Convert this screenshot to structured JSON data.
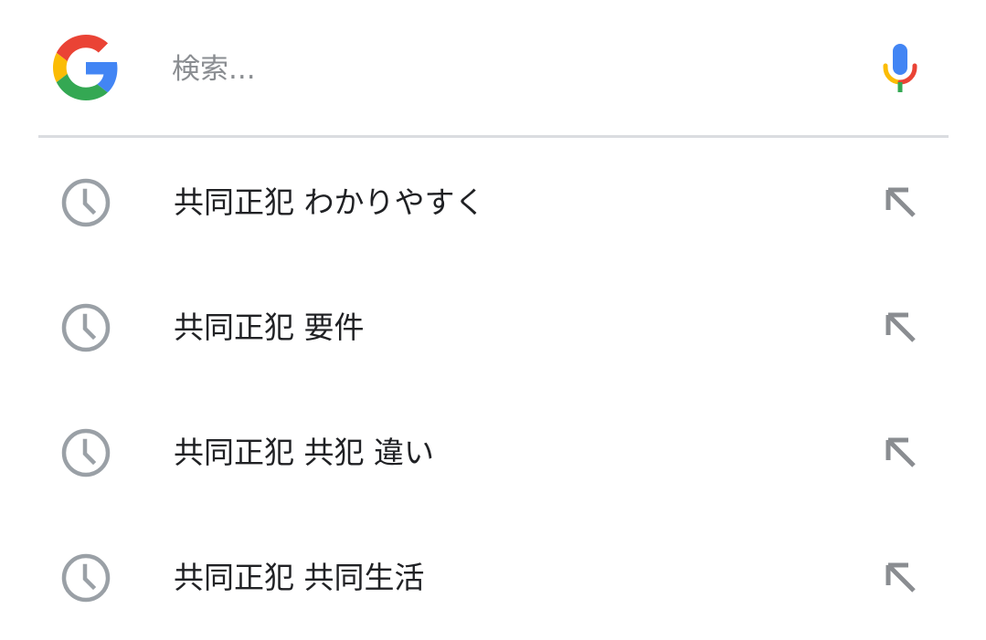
{
  "search": {
    "placeholder": "検索...",
    "value": ""
  },
  "icons": {
    "logo": "google-g-logo-icon",
    "mic": "microphone-icon",
    "history": "clock-history-icon",
    "fill": "arrow-up-left-icon"
  },
  "colors": {
    "google_blue": "#4285F4",
    "google_red": "#EA4335",
    "google_yellow": "#FBBC05",
    "google_green": "#34A853",
    "icon_gray": "#9aa0a6",
    "text": "#202124",
    "placeholder": "#8a8d91",
    "divider": "#dadce0"
  },
  "suggestions": [
    {
      "label": "共同正犯 わかりやすく"
    },
    {
      "label": "共同正犯 要件"
    },
    {
      "label": "共同正犯 共犯 違い"
    },
    {
      "label": "共同正犯 共同生活"
    }
  ]
}
